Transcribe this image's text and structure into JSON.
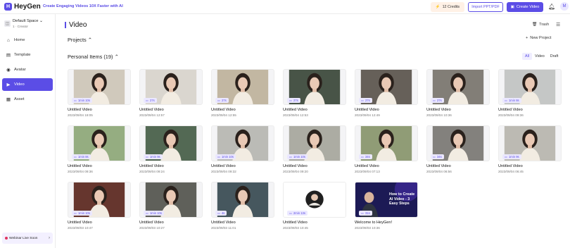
{
  "header": {
    "brand": "HeyGen",
    "logo_letter": "H",
    "tagline": "Create Engaging Videos 10X Faster with AI",
    "credits": "12 Credits",
    "import_label": "Import PPT/PDF",
    "create_label": "Create Video",
    "avatar_initial": "M"
  },
  "sidebar": {
    "space_name": "Default Space",
    "space_meta": "1 · Creator",
    "items": [
      {
        "label": "Home",
        "icon": "home-icon"
      },
      {
        "label": "Template",
        "icon": "template-icon"
      },
      {
        "label": "Avatar",
        "icon": "avatar-icon"
      },
      {
        "label": "Video",
        "icon": "video-icon"
      },
      {
        "label": "Asset",
        "icon": "asset-icon"
      }
    ],
    "active_index": 3,
    "webinar": "Webinar Live Soon"
  },
  "main": {
    "title": "Video",
    "trash": "Trash",
    "projects": "Projects",
    "new_project": "New Project",
    "personal": "Personal Items (19)",
    "filters": [
      "All",
      "Video",
      "Draft"
    ],
    "active_filter": 0
  },
  "cards": [
    {
      "title": "Untitled Video",
      "date": "2023/09/04 18:05",
      "duration": "1min 10s",
      "kind": "girl",
      "bg": "#ded6c8"
    },
    {
      "title": "Untitled Video",
      "date": "2023/09/04 12:57",
      "duration": "27s",
      "kind": "girl",
      "bg": "#e8e4dc"
    },
    {
      "title": "Untitled Video",
      "date": "2023/09/04 12:55",
      "duration": "27s",
      "kind": "girl",
      "bg": "#cfc3ad"
    },
    {
      "title": "Untitled Video",
      "date": "2023/09/04 12:53",
      "duration": "27s",
      "kind": "girl",
      "bg": "#4d5a4c"
    },
    {
      "title": "Untitled Video",
      "date": "2023/09/04 12:49",
      "duration": "27s",
      "kind": "girl",
      "bg": "#6d675f"
    },
    {
      "title": "Untitled Video",
      "date": "2023/09/04 10:36",
      "duration": "27s",
      "kind": "girl",
      "bg": "#8b867f"
    },
    {
      "title": "Untitled Video",
      "date": "2023/09/04 09:36",
      "duration": "1min 8s",
      "kind": "girl",
      "bg": "#d2d4d3"
    },
    {
      "title": "Untitled Video",
      "date": "2023/09/04 09:36",
      "duration": "1min 8s",
      "kind": "girl",
      "bg": "#9fb88a"
    },
    {
      "title": "Untitled Video",
      "date": "2023/09/04 09:24",
      "duration": "1min 9s",
      "kind": "girl",
      "bg": "#59705a"
    },
    {
      "title": "Untitled Video",
      "date": "2023/09/04 09:32",
      "duration": "1min 10s",
      "kind": "girl",
      "bg": "#c7c7c2"
    },
    {
      "title": "Untitled Video",
      "date": "2023/09/04 09:20",
      "duration": "1min 10s",
      "kind": "girl",
      "bg": "#b7b7ae"
    },
    {
      "title": "Untitled Video",
      "date": "2023/09/04 07:13",
      "duration": "34s",
      "kind": "girl",
      "bg": "#9aa67e"
    },
    {
      "title": "Untitled Video",
      "date": "2023/09/04 06:56",
      "duration": "34s",
      "kind": "girl",
      "bg": "#8c8a85"
    },
    {
      "title": "Untitled Video",
      "date": "2023/09/04 06:45",
      "duration": "1min 9s",
      "kind": "girl",
      "bg": "#c8c6bf"
    },
    {
      "title": "Untitled Video",
      "date": "2023/09/03 10:47",
      "duration": "1min 10s",
      "kind": "girl",
      "bg": "#6d3a31"
    },
    {
      "title": "Untitled Video",
      "date": "2023/09/03 10:27",
      "duration": "1min 10s",
      "kind": "girl",
      "bg": "#656760"
    },
    {
      "title": "Untitled Video",
      "date": "2023/09/03 11:01",
      "duration": "4s",
      "kind": "girl",
      "bg": "#4b5d64"
    },
    {
      "title": "Untitled Video",
      "date": "2023/09/03 10:45",
      "duration": "2min 13s",
      "kind": "circle",
      "bg": "#ffffff"
    },
    {
      "title": "Welcome to HeyGen!",
      "date": "2023/09/03 10:36",
      "duration": "31s",
      "kind": "promo",
      "bg": "#1c1a55",
      "promo_text": "How to Create AI Video - 3 Easy Steps"
    }
  ]
}
